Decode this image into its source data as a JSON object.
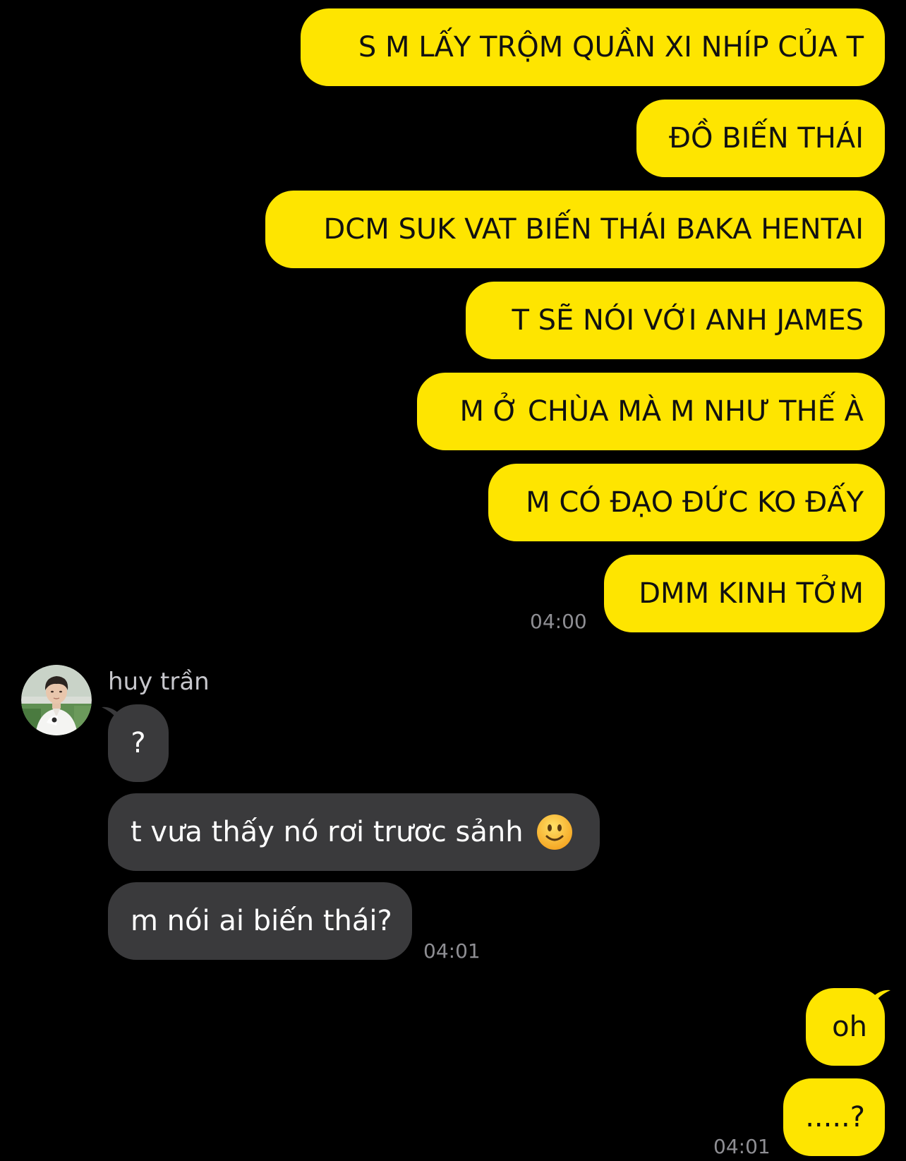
{
  "colors": {
    "background": "#000000",
    "sent_bubble": "#FEE500",
    "received_bubble": "#3A3A3C",
    "timestamp": "#8E8E93"
  },
  "sent_group_1": {
    "messages": [
      "S M LẤY TRỘM QUẦN XI NHÍP CỦA T",
      "ĐỒ BIẾN THÁI",
      "DCM SUK VAT BIẾN THÁI BAKA HENTAI",
      "T SẼ NÓI VỚI ANH JAMES",
      "M Ở CHÙA MÀ M NHƯ THẾ À",
      "M CÓ ĐẠO ĐỨC KO ĐẤY",
      "DMM KINH TỞM"
    ],
    "time": "04:00"
  },
  "received_group": {
    "sender": "huy trần",
    "avatar_icon": "profile-photo-avatar",
    "messages": [
      "?",
      "t vưa thấy nó rơi trươc sảnh",
      "m nói ai biến thái?"
    ],
    "emoji_icon": "slightly-smiling-face-emoji",
    "time": "04:01"
  },
  "sent_group_2": {
    "messages": [
      "oh",
      ".....?"
    ],
    "time": "04:01"
  }
}
